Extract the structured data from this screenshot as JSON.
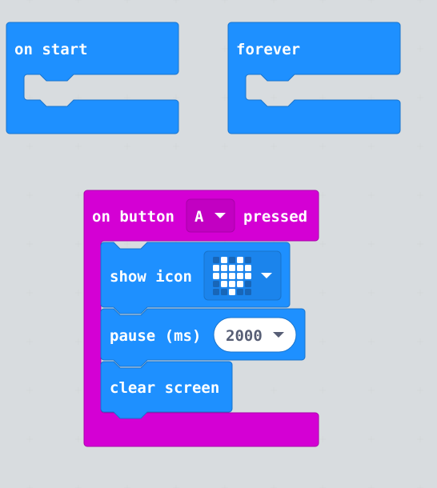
{
  "colors": {
    "workspace": "#ecf0f1",
    "basic_block": "#1e90ff",
    "basic_block_dark": "#1873cc",
    "input_block": "#d400d4",
    "input_block_dark": "#aa00aa",
    "text": "#ffffff",
    "oval_text": "#575e75"
  },
  "blocks": {
    "on_start": {
      "label": "on start"
    },
    "forever": {
      "label": "forever"
    },
    "on_button_pressed": {
      "prefix": "on button",
      "button_value": "A",
      "suffix": "pressed",
      "body": {
        "show_icon": {
          "label": "show icon",
          "icon": "heart-icon"
        },
        "pause": {
          "label": "pause (ms)",
          "value": "2000"
        },
        "clear_screen": {
          "label": "clear screen"
        }
      }
    }
  }
}
